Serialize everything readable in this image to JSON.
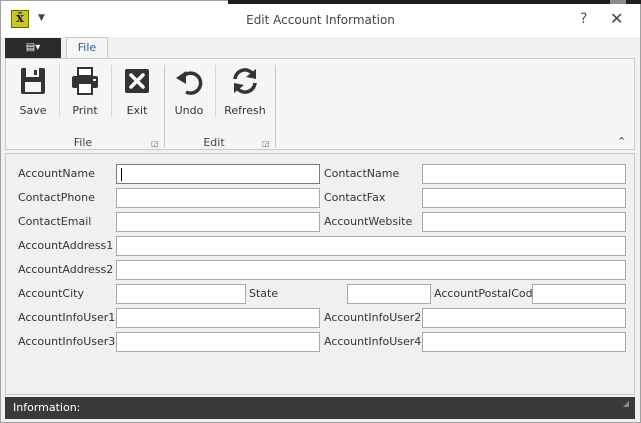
{
  "window": {
    "title": "Edit Account Information",
    "help": "?",
    "close": "✕",
    "app_icon_glyph": "x̄"
  },
  "ribbon": {
    "app_menu_glyph": "▤▾",
    "tabs": [
      {
        "label": "File",
        "active": true
      }
    ],
    "groups": [
      {
        "label": "File",
        "buttons": [
          {
            "label": "Save",
            "icon": "save-icon"
          },
          {
            "label": "Print",
            "icon": "print-icon"
          },
          {
            "label": "Exit",
            "icon": "exit-icon"
          }
        ]
      },
      {
        "label": "Edit",
        "buttons": [
          {
            "label": "Undo",
            "icon": "undo-icon"
          },
          {
            "label": "Refresh",
            "icon": "refresh-icon"
          }
        ]
      }
    ],
    "collapse_glyph": "⌃"
  },
  "form": {
    "fields": {
      "account_name": {
        "label": "AccountName",
        "value": ""
      },
      "contact_name": {
        "label": "ContactName",
        "value": ""
      },
      "contact_phone": {
        "label": "ContactPhone",
        "value": ""
      },
      "contact_fax": {
        "label": "ContactFax",
        "value": ""
      },
      "contact_email": {
        "label": "ContactEmail",
        "value": ""
      },
      "account_website": {
        "label": "AccountWebsite",
        "value": ""
      },
      "account_address1": {
        "label": "AccountAddress1",
        "value": ""
      },
      "account_address2": {
        "label": "AccountAddress2",
        "value": ""
      },
      "account_city": {
        "label": "AccountCity",
        "value": ""
      },
      "state": {
        "label": "State",
        "value": ""
      },
      "account_postal_code": {
        "label": "AccountPostalCode",
        "value": ""
      },
      "account_info_user1": {
        "label": "AccountInfoUser1",
        "value": ""
      },
      "account_info_user2": {
        "label": "AccountInfoUser2",
        "value": ""
      },
      "account_info_user3": {
        "label": "AccountInfoUser3",
        "value": ""
      },
      "account_info_user4": {
        "label": "AccountInfoUser4",
        "value": ""
      }
    }
  },
  "status": {
    "label": "Information:",
    "value": ""
  },
  "colors": {
    "accent": "#2b5797",
    "app_icon": "#c7c72a",
    "status_bar": "#3a3a3a"
  }
}
